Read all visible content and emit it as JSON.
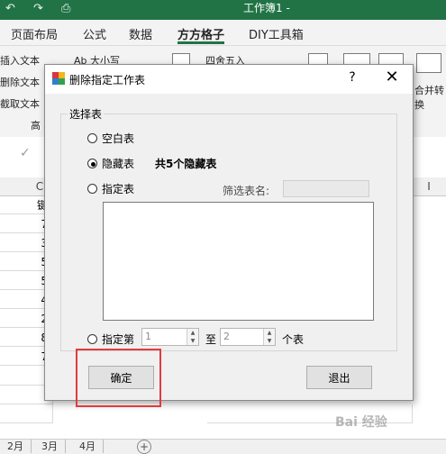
{
  "excel": {
    "window_title": "工作簿1 -",
    "ribbon_tabs": [
      "页面布局",
      "公式",
      "数据",
      "方方格子",
      "DIY工具箱"
    ],
    "active_tab": "方方格子",
    "ribbon_left_items": [
      "插入文本",
      "删除文本",
      "截取文本"
    ],
    "ribbon_items": {
      "case": "Ab 大小写",
      "round": "四舍五入",
      "merge": "合并转换",
      "group_label": "高"
    },
    "column_headers": [
      "C",
      "I"
    ],
    "cells": [
      "键",
      "7",
      "3",
      "5",
      "5",
      "4",
      "2",
      "8",
      "7"
    ],
    "sheet_tabs": [
      "2月",
      "3月",
      "4月"
    ],
    "add_sheet": "+"
  },
  "dialog": {
    "title": "删除指定工作表",
    "help": "?",
    "close": "✕",
    "group_label": "选择表",
    "options": {
      "blank": "空白表",
      "hidden": "隐藏表",
      "specified": "指定表",
      "range": "指定第"
    },
    "selected_option": "hidden",
    "hidden_count_note": "共5个隐藏表",
    "filter_label": "筛选表名:",
    "filter_value": "",
    "range_from": "1",
    "range_to_label": "至",
    "range_to": "2",
    "range_unit": "个表",
    "ok_button": "确定",
    "exit_button": "退出"
  },
  "watermark": "Bai 经验",
  "colors": {
    "excel_green": "#217346",
    "highlight": "#e23b3b"
  }
}
